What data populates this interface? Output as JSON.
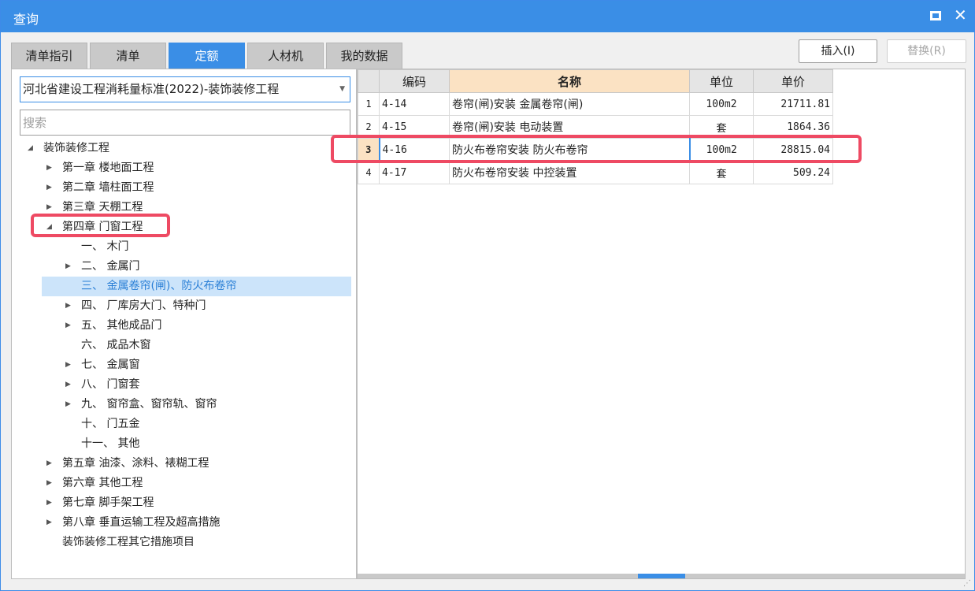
{
  "window": {
    "title": "查询"
  },
  "tabs": [
    {
      "label": "清单指引"
    },
    {
      "label": "清单"
    },
    {
      "label": "定额",
      "active": true
    },
    {
      "label": "人材机"
    },
    {
      "label": "我的数据"
    }
  ],
  "toolbar": {
    "insert_label": "插入(I)",
    "replace_label": "替换(R)"
  },
  "library": {
    "selected": "河北省建设工程消耗量标准(2022)-装饰装修工程"
  },
  "search": {
    "placeholder": "搜索",
    "value": ""
  },
  "tree": {
    "root": "装饰装修工程",
    "chapters": [
      "第一章 楼地面工程",
      "第二章 墙柱面工程",
      "第三章 天棚工程",
      "第四章 门窗工程"
    ],
    "chapter4_children": [
      "一、 木门",
      "二、 金属门",
      "三、 金属卷帘(闸)、防火布卷帘",
      "四、 厂库房大门、特种门",
      "五、 其他成品门",
      "六、 成品木窗",
      "七、 金属窗",
      "八、 门窗套",
      "九、 窗帘盒、窗帘轨、窗帘",
      "十、 门五金",
      "十一、 其他"
    ],
    "later_chapters": [
      "第五章 油漆、涂料、裱糊工程",
      "第六章 其他工程",
      "第七章 脚手架工程",
      "第八章 垂直运输工程及超高措施",
      "装饰装修工程其它措施项目"
    ]
  },
  "grid": {
    "columns": [
      "编码",
      "名称",
      "单位",
      "单价"
    ],
    "rows": [
      {
        "num": "1",
        "code": "4-14",
        "name": "卷帘(闸)安装 金属卷帘(闸)",
        "unit": "100m2",
        "price": "21711.81"
      },
      {
        "num": "2",
        "code": "4-15",
        "name": "卷帘(闸)安装 电动装置",
        "unit": "套",
        "price": "1864.36"
      },
      {
        "num": "3",
        "code": "4-16",
        "name": "防火布卷帘安装 防火布卷帘",
        "unit": "100m2",
        "price": "28815.04"
      },
      {
        "num": "4",
        "code": "4-17",
        "name": "防火布卷帘安装 中控装置",
        "unit": "套",
        "price": "509.24"
      }
    ]
  },
  "colors": {
    "accent": "#3a8ee6",
    "highlight_border": "#ee4a63",
    "selected_row_bg": "#cce4fa",
    "sorted_header_bg": "#fbe2c3"
  }
}
